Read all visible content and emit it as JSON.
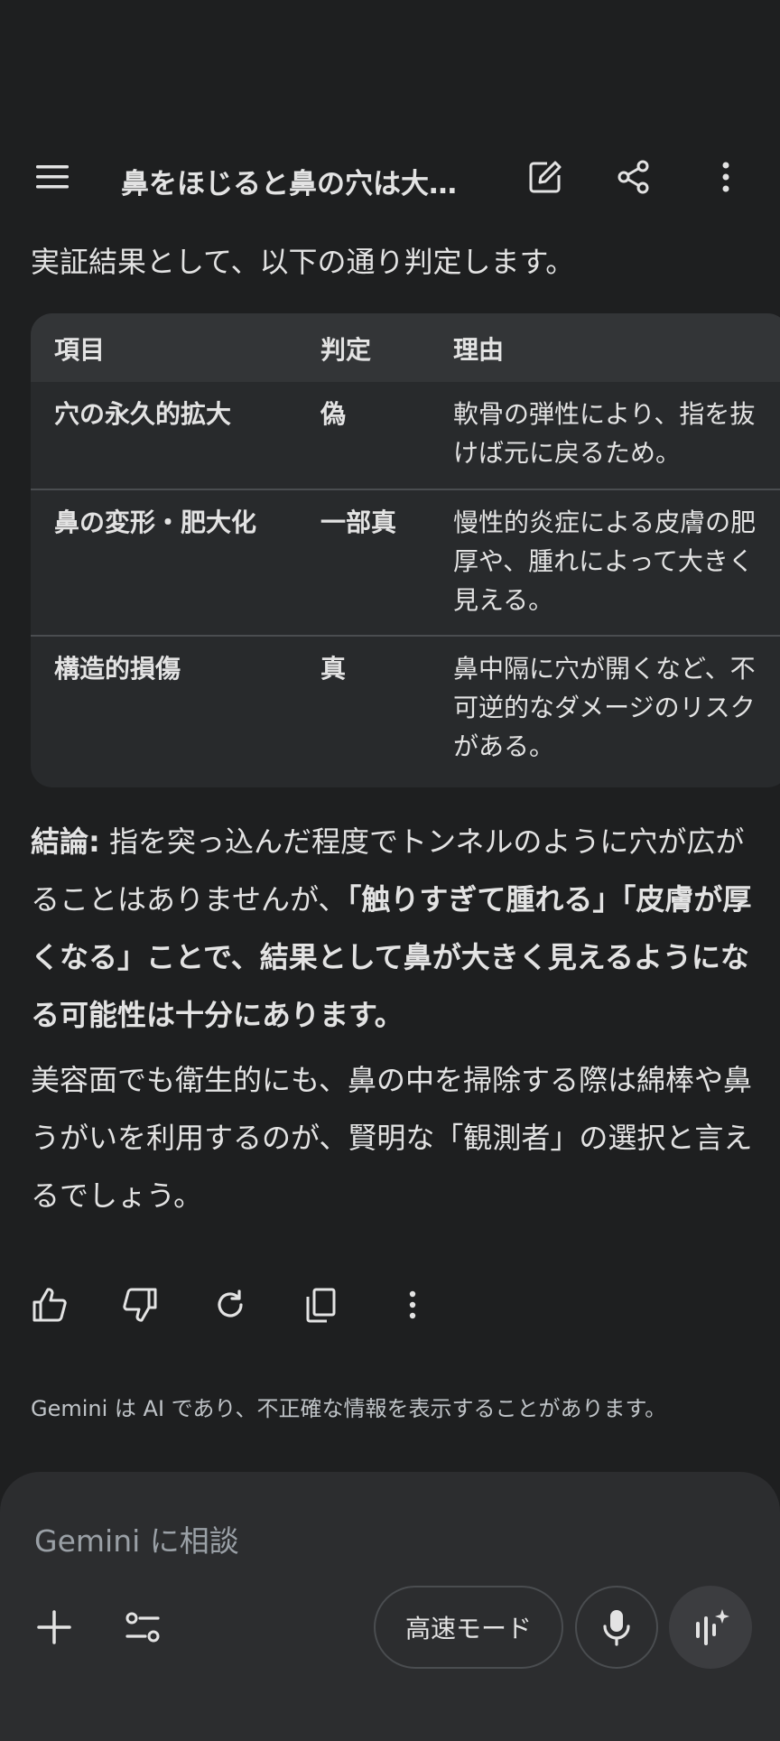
{
  "header": {
    "title": "鼻をほじると鼻の穴は大…"
  },
  "intro_text": "実証結果として、以下の通り判定します。",
  "table": {
    "headers": [
      "項目",
      "判定",
      "理由"
    ],
    "rows": [
      {
        "item": "穴の永久的拡大",
        "verdict": "偽",
        "reason": "軟骨の弾性により、指を抜けば元に戻るため。"
      },
      {
        "item": "鼻の変形・肥大化",
        "verdict": "一部真",
        "reason": "慢性的炎症による皮膚の肥厚や、腫れによって大きく見える。"
      },
      {
        "item": "構造的損傷",
        "verdict": "真",
        "reason": "鼻中隔に穴が開くなど、不可逆的なダメージのリスクがある。"
      }
    ]
  },
  "conclusion": {
    "label": "結論:",
    "text1": " 指を突っ込んだ程度でトンネルのように穴が広がることはありませんが、",
    "bold1": "「触りすぎて腫れる」「皮膚が厚くなる」ことで、結果として鼻が大きく見えるようになる可能性は十分にあります。"
  },
  "closing_text": "美容面でも衛生的にも、鼻の中を掃除する際は綿棒や鼻うがいを利用するのが、賢明な「観測者」の選択と言えるでしょう。",
  "disclaimer": "Gemini は AI であり、不正確な情報を表示することがあります。",
  "composer": {
    "placeholder": "Gemini に相談",
    "mode_label": "高速モード"
  },
  "colors": {
    "background": "#1e1f20",
    "table_bg": "#282a2c",
    "table_header_bg": "#333537",
    "composer_bg": "#2c2d2f",
    "text": "#e3e3e3"
  },
  "icons": [
    "menu-icon",
    "edit-icon",
    "share-icon",
    "more-vert-icon",
    "thumb-up-icon",
    "thumb-down-icon",
    "refresh-icon",
    "copy-icon",
    "add-icon",
    "tune-icon",
    "mic-icon",
    "live-icon"
  ]
}
